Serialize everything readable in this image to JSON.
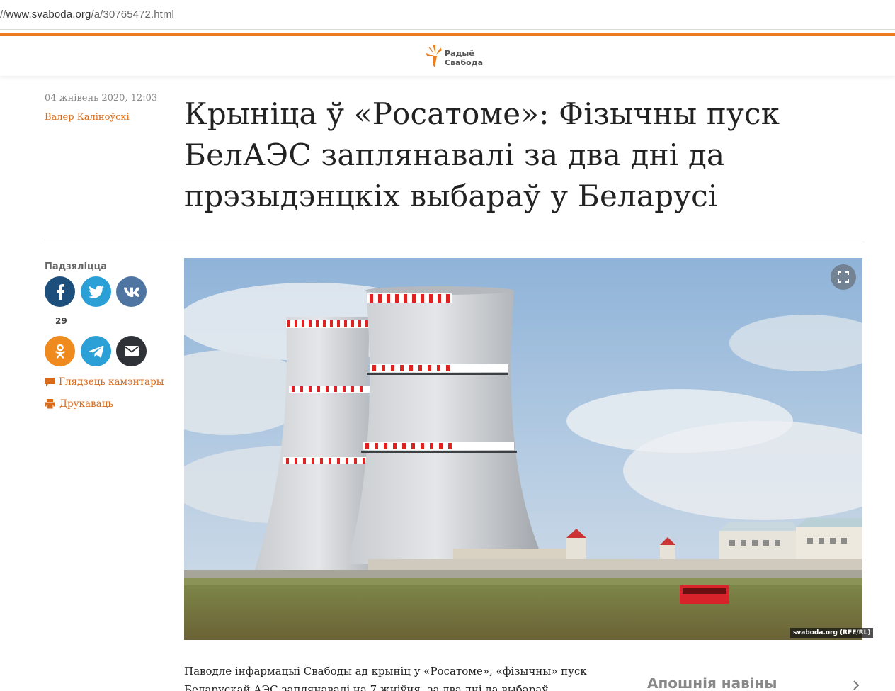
{
  "browser": {
    "url_prefix": "//",
    "url_host": "www.svaboda.org",
    "url_path": "/a/30765472.html"
  },
  "site": {
    "logo_line1": "Радыё",
    "logo_line2": "Свабода",
    "brand_color": "#ee7d1d"
  },
  "article": {
    "date": "04 жнівень 2020, 12:03",
    "author": "Валер Каліноўскі",
    "headline": "Крыніца ў «Росатоме»: Фізычны пуск БелАЭС заплянавалі за два дні да прэзыдэнцкіх выбараў у Беларусі",
    "lead": "Паводле інфармацыі Свабоды ад крыніц у «Росатоме», «фізычны» пуск Беларускай АЭС заплянавалі на 7 жніўня, за два дні да выбараў прэзыдэнта"
  },
  "share": {
    "label": "Падзяліцца",
    "facebook_count": "29",
    "buttons": [
      "facebook-icon",
      "twitter-icon",
      "vk-icon",
      "odnoklassniki-icon",
      "telegram-icon",
      "email-icon"
    ]
  },
  "links": {
    "comments": "Глядзець камэнтары",
    "print": "Друкаваць"
  },
  "photo": {
    "credit": "svaboda.org (RFE/RL)"
  },
  "sidebar": {
    "latest_title": "Апошнія навіны"
  }
}
